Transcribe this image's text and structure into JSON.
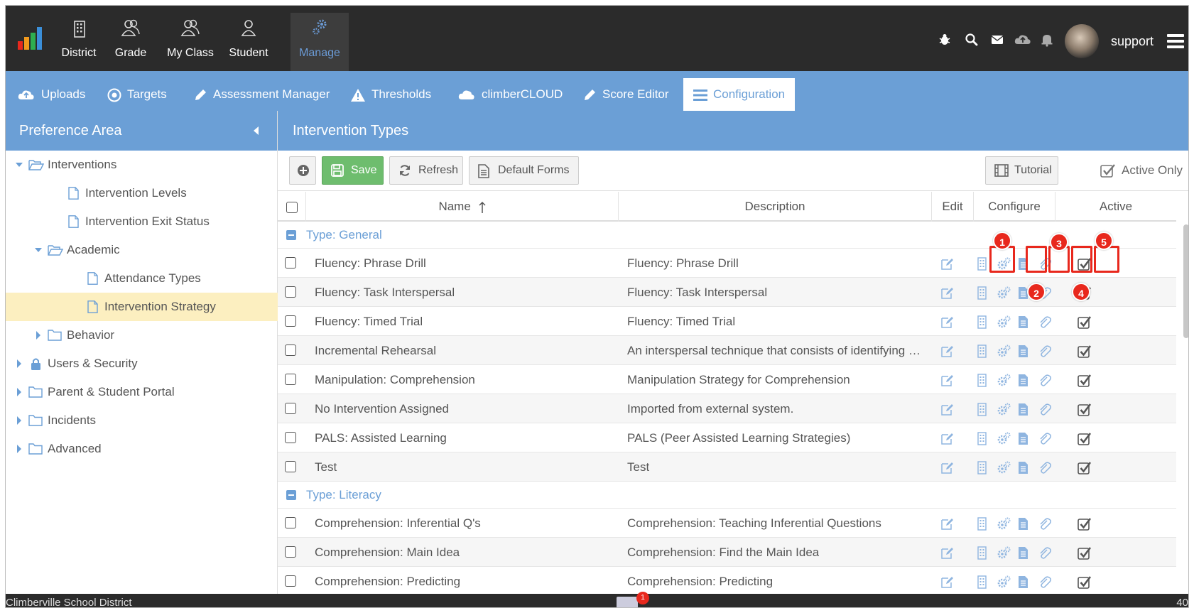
{
  "topnav": {
    "items": [
      {
        "label": "District",
        "icon": "building-icon"
      },
      {
        "label": "Grade",
        "icon": "users-icon"
      },
      {
        "label": "My Class",
        "icon": "users-icon"
      },
      {
        "label": "Student",
        "icon": "user-icon"
      },
      {
        "label": "Manage",
        "icon": "gears-icon",
        "active": true
      }
    ],
    "right_icons": [
      "bug-icon",
      "search-icon",
      "mail-icon",
      "cloud-upload-icon",
      "bell-icon"
    ],
    "username": "support"
  },
  "subnav": {
    "tabs": [
      {
        "label": "Uploads",
        "icon": "cloud-upload-icon"
      },
      {
        "label": "Targets",
        "icon": "target-icon"
      },
      {
        "label": "Assessment Manager",
        "icon": "pencil-icon"
      },
      {
        "label": "Thresholds",
        "icon": "warning-icon"
      },
      {
        "label": "climberCLOUD",
        "icon": "cloud-icon"
      },
      {
        "label": "Score Editor",
        "icon": "pencil-icon"
      },
      {
        "label": "Configuration",
        "icon": "list-icon",
        "active": true
      }
    ]
  },
  "left_panel": {
    "title": "Preference Area",
    "tree": [
      {
        "label": "Interventions",
        "level": 0,
        "type": "folder-open",
        "expanded": true
      },
      {
        "label": "Intervention Levels",
        "level": 1,
        "type": "file"
      },
      {
        "label": "Intervention Exit Status",
        "level": 1,
        "type": "file"
      },
      {
        "label": "Academic",
        "level": 1,
        "type": "folder-open",
        "expanded": true
      },
      {
        "label": "Attendance Types",
        "level": 2,
        "type": "file"
      },
      {
        "label": "Intervention Strategy",
        "level": 2,
        "type": "file",
        "selected": true
      },
      {
        "label": "Behavior",
        "level": 1,
        "type": "folder",
        "expanded": false
      },
      {
        "label": "Users & Security",
        "level": 0,
        "type": "lock",
        "expanded": false
      },
      {
        "label": "Parent & Student Portal",
        "level": 0,
        "type": "folder",
        "expanded": false
      },
      {
        "label": "Incidents",
        "level": 0,
        "type": "folder",
        "expanded": false
      },
      {
        "label": "Advanced",
        "level": 0,
        "type": "folder",
        "expanded": false
      }
    ]
  },
  "main": {
    "title": "Intervention Types",
    "toolbar": {
      "save": "Save",
      "refresh": "Refresh",
      "default_forms": "Default Forms",
      "tutorial": "Tutorial",
      "active_only": "Active Only"
    },
    "columns": {
      "name": "Name",
      "description": "Description",
      "edit": "Edit",
      "configure": "Configure",
      "active": "Active"
    },
    "groups": [
      {
        "label": "Type: General",
        "rows": [
          {
            "name": "Fluency: Phrase Drill",
            "description": "Fluency: Phrase Drill"
          },
          {
            "name": "Fluency: Task Interspersal",
            "description": "Fluency: Task Interspersal"
          },
          {
            "name": "Fluency: Timed Trial",
            "description": "Fluency: Timed Trial"
          },
          {
            "name": "Incremental Rehearsal",
            "description": "An interspersal technique that consists of identifying nine k..."
          },
          {
            "name": "Manipulation: Comprehension",
            "description": "Manipulation Strategy for Comprehension"
          },
          {
            "name": "No Intervention Assigned",
            "description": "Imported from external system."
          },
          {
            "name": "PALS: Assisted Learning",
            "description": "PALS (Peer Assisted Learning Strategies)"
          },
          {
            "name": "Test",
            "description": "Test"
          }
        ]
      },
      {
        "label": "Type: Literacy",
        "rows": [
          {
            "name": "Comprehension: Inferential Q's",
            "description": "Comprehension: Teaching Inferential Questions"
          },
          {
            "name": "Comprehension: Main Idea",
            "description": "Comprehension: Find the Main Idea"
          },
          {
            "name": "Comprehension: Predicting",
            "description": "Comprehension: Predicting"
          }
        ]
      }
    ],
    "annotations": [
      "1",
      "2",
      "3",
      "4",
      "5"
    ]
  },
  "footer": {
    "district": "Climberville School District",
    "mail_count": "1",
    "right_text": "40"
  },
  "colors": {
    "accent": "#6b9fd6",
    "dark_nav": "#2b2b2b",
    "save_green": "#6ebd6e",
    "highlight_red": "#e8281d",
    "selected_bg": "#fcefc0"
  }
}
